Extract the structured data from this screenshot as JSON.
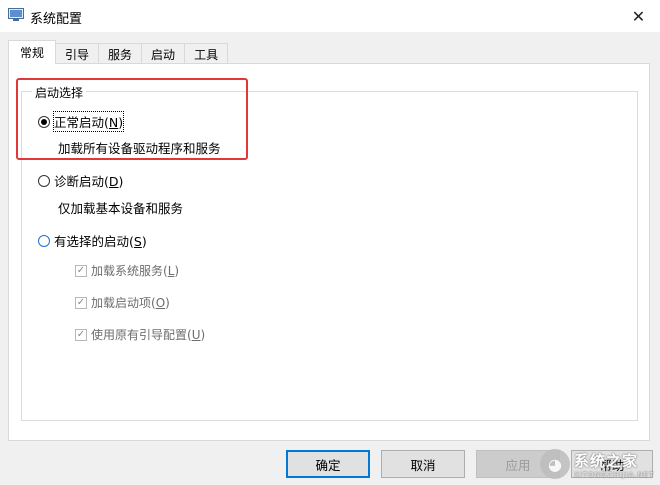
{
  "window": {
    "title": "系统配置",
    "close_glyph": "✕"
  },
  "tabs": [
    {
      "label": "常规",
      "active": true
    },
    {
      "label": "引导",
      "active": false
    },
    {
      "label": "服务",
      "active": false
    },
    {
      "label": "启动",
      "active": false
    },
    {
      "label": "工具",
      "active": false
    }
  ],
  "group": {
    "legend": "启动选择",
    "options": [
      {
        "label": "正常启动",
        "hotkey": "N",
        "description": "加载所有设备驱动程序和服务",
        "selected": true
      },
      {
        "label": "诊断启动",
        "hotkey": "D",
        "description": "仅加载基本设备和服务",
        "selected": false
      },
      {
        "label": "有选择的启动",
        "hotkey": "S",
        "selected": false
      }
    ],
    "selective_items": [
      {
        "label": "加载系统服务",
        "hotkey": "L",
        "checked": true,
        "enabled": false
      },
      {
        "label": "加载启动项",
        "hotkey": "O",
        "checked": true,
        "enabled": false
      },
      {
        "label": "使用原有引导配置",
        "hotkey": "U",
        "checked": true,
        "enabled": false
      }
    ]
  },
  "buttons": {
    "ok": "确定",
    "cancel": "取消",
    "apply": "应用",
    "help": "帮助"
  },
  "watermark": {
    "cn": "系统之家",
    "en": "XITONGZHIJIA.NET"
  },
  "colors": {
    "highlight": "#e0383a",
    "primary_border": "#0078d7",
    "panel_bg": "#ffffff",
    "dialog_bg": "#f0f0f0"
  }
}
